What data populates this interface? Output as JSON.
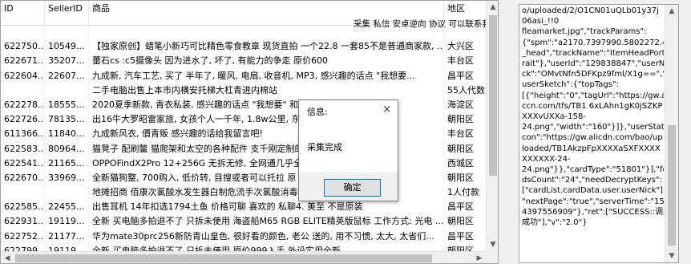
{
  "grid": {
    "headers": {
      "id": "ID",
      "seller_id": "SellerID",
      "product": "商品",
      "region": "地区"
    },
    "overflow_line": "采集 私信 安卓逆向 协议 可以联系我",
    "rows": [
      {
        "id": "",
        "seller_id": "",
        "product": "",
        "region": ""
      },
      {
        "id": "622750...",
        "seller_id": "10549...",
        "product": "【独家原创】蜡笔小新巧可比精色零食教章   现货直拍 一个22.8 一套85不是普通商家款, ...",
        "region": "大兴区"
      },
      {
        "id": "622671...",
        "seller_id": "35207...",
        "product": "蕾石cs :c5摄像头 因为进水了, 坏了, 有能力的争走 原价600",
        "region": "丰台区"
      },
      {
        "id": "622604...",
        "seller_id": "22607...",
        "product": "九成新, 汽车工艺, 买了 半年了, 暖风, 电扇, 收音机, MP3, 感兴趣的话点  \"我想要...",
        "region": "昌平区"
      },
      {
        "id": "",
        "seller_id": "",
        "product": "二手电脑出售上本市内横安托梯大杠青进内棉站",
        "region": "55人代数"
      },
      {
        "id": "622278...",
        "seller_id": "18555...",
        "product": "2020夏季新款, 青衣私装, 感兴趣的话点 \"我想要\" 和",
        "region": "海淀区"
      },
      {
        "id": "622726...",
        "seller_id": "78135...",
        "product": "出16牛大罗昭雷家旅, 女孩个人一千年, 1.8w公里, 东",
        "region": "朝阳区"
      },
      {
        "id": "611366...",
        "seller_id": "11840...",
        "product": "九成新风衣, 價青贩 感兴趣的话给我留言吧!",
        "region": "丰台区"
      },
      {
        "id": "622583...",
        "seller_id": "80964...",
        "product": "猫凳子 配刷鳖 猫爬架和太空的各种配件 支千刚定制的, ...价钱打1 20*...",
        "region": "朝阳区"
      },
      {
        "id": "622541...",
        "seller_id": "21165...",
        "product": "OPPOFindX2Pro 12+256G 无拆无修, 全网通几乎全新",
        "region": "西城区"
      },
      {
        "id": "622670...",
        "seller_id": "33969...",
        "product": "全新猫狗整, 700购入, 低价转, 目搜或者可以托拉 原",
        "region": "朝阳区"
      },
      {
        "id": "",
        "seller_id": "",
        "product": "地摊招商 佰康次氯酸水发生器白制危流手次氯酸消毒液",
        "region": "1人付款"
      },
      {
        "id": "622585...",
        "seller_id": "22455...",
        "product": "出售耳机 14年扣选1794土鱼 价格可聊 喜欢的 私聊4. 美至 不是原装",
        "region": "昌平区"
      },
      {
        "id": "622931...",
        "seller_id": "19119...",
        "product": "全新  买电脑多拍退不了  只拆未使用 海盗船M65 RGB ELITE精英版鼠标 工作方式: 光电 ...",
        "region": "朝阳区"
      },
      {
        "id": "622752...",
        "seller_id": "21177...",
        "product": "华为mate30prc256新防青山皇色, 很好看的颜色, 老公 送的, 用不习惯, 太大, 太省们...",
        "region": "昌平区"
      },
      {
        "id": "622799...",
        "seller_id": "19119...",
        "product": "全新  买电脑多拍退不了  只拆未使用 原价999入手 外设实用全新 ...",
        "region": "朝阳区"
      }
    ]
  },
  "dialog": {
    "title": "信息:",
    "close_glyph": "×",
    "message": "采集完成",
    "ok_label": "确定"
  },
  "detail_text": [
    "o/uploaded/2/O1CN01uQLb01y37j",
    "06asi_!!0",
    "fleamarket.jpg\",\"trackParams\":",
    "{\"spm\":\"a2170.7397990.5802272.43",
    "_head\",\"trackName\":\"ItemHeadPort",
    "rait\"},\"userId\":\"129838847\",\"userNi",
    "ck\":\"OMvtNfn5DFKpz9fml/X1g==\",\"",
    "userSketch\":{\"topTags\":",
    "[{\"height\":\"0\",\"tagUrl\":\"https://gw.ali",
    "ccn.com/tfs/TB1 6xLAhn1gK0jSZKP",
    "XXXvUXXa-158-",
    "24.png\",\"width\":\"160\"}]},\"userStatel",
    "con\":\"https://gw.alicdn.com/bao/up",
    "loaded/TB1AkzpFpXXXXaSXFXXXX",
    "XXXXXX-24-",
    "24.png\"}},\"cardType\":\"51801\"}],\"fee",
    "dsCount\":\"24\",\"needDecryptKeys\":",
    "[\"cardList.cardData.user.userNick\"],",
    "\"nextPage\":\"true\",\"serverTime\":\"159",
    "4397556909\"},\"ret\":[\"SUCCESS::调用",
    "成功\"],\"v\":\"2.0\"}"
  ]
}
